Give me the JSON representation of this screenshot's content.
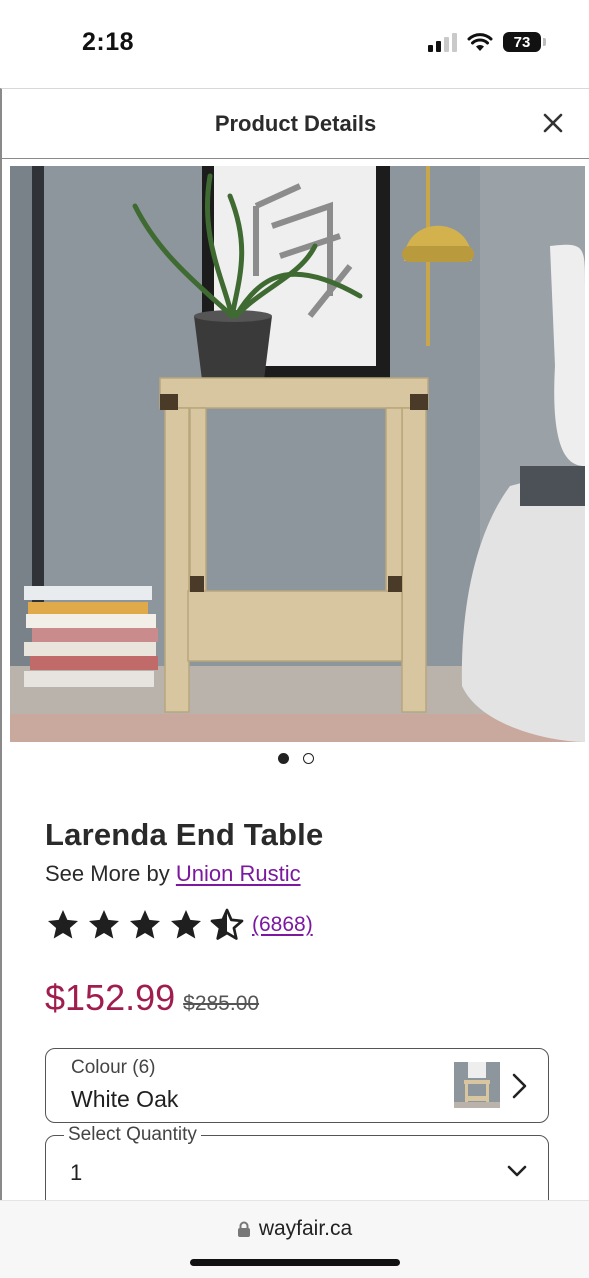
{
  "status_bar": {
    "time": "2:18",
    "battery": "73",
    "icons": [
      "cellular-signal-icon",
      "wifi-icon",
      "battery-icon"
    ]
  },
  "header": {
    "title": "Product Details",
    "close_icon": "close-icon"
  },
  "product": {
    "image_alt": "Larenda End Table",
    "carousel": {
      "total": 2,
      "active": 1
    },
    "title": "Larenda End Table",
    "brand_prefix": "See More by",
    "brand": "Union Rustic",
    "rating": 4.5,
    "review_count": "(6868)",
    "sale_price": "$152.99",
    "list_price": "$285.00"
  },
  "options": {
    "colour": {
      "label": "Colour (6)",
      "value": "White Oak",
      "chevron_icon": "chevron-right-icon"
    },
    "quantity": {
      "label": "Select Quantity",
      "value": "1",
      "chevron_icon": "chevron-down-icon"
    }
  },
  "browser": {
    "url": "wayfair.ca",
    "lock_icon": "lock-icon"
  },
  "colors": {
    "price": "#a01e4f",
    "link": "#7b189f",
    "text": "#2a2a2a"
  }
}
